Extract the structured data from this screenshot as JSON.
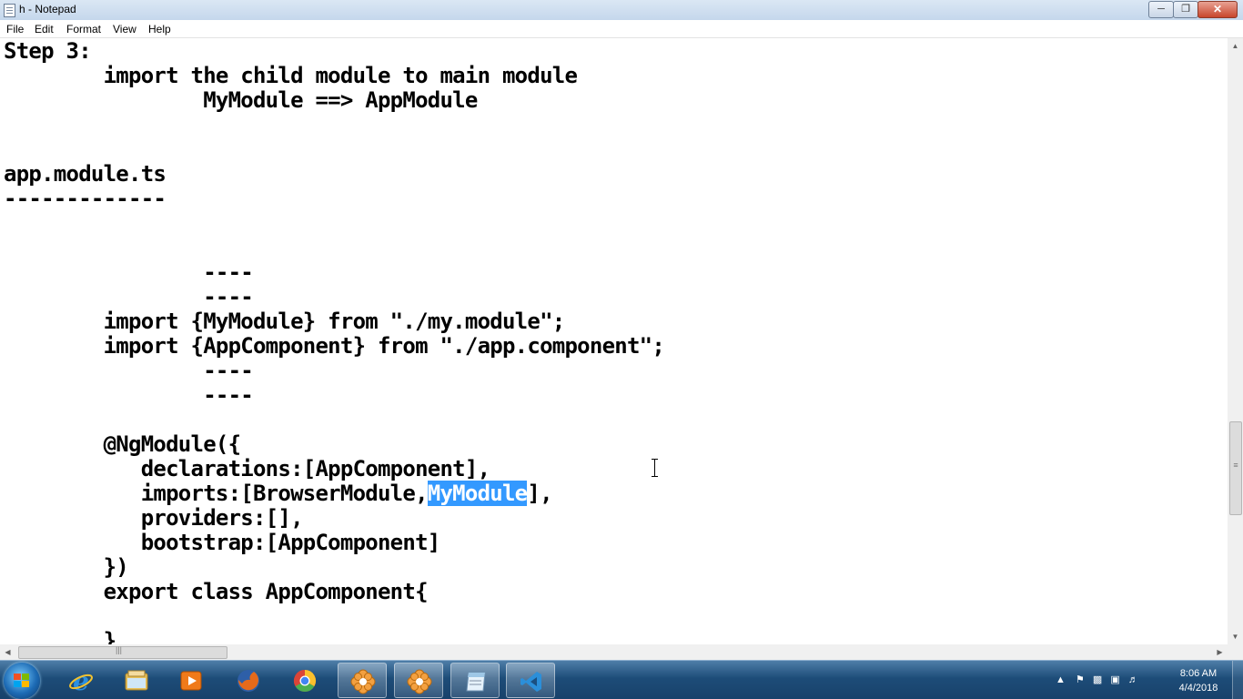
{
  "window": {
    "title": "h - Notepad",
    "controls": {
      "minimize": "minimize",
      "maximize": "restore",
      "close": "close"
    }
  },
  "menu": [
    "File",
    "Edit",
    "Format",
    "View",
    "Help"
  ],
  "editor": {
    "lines_before": "Step 3:\n\timport the child module to main module\n\t\tMyModule ==> AppModule\n\n\napp.module.ts\n-------------\n\n\n\t\t----\n\t\t----\n\timport {MyModule} from \"./my.module\";\n\timport {AppComponent} from \"./app.component\";\n\t\t----\n\t\t----\n\n\t@NgModule({\n\t   declarations:[AppComponent],\n\t   imports:[BrowserModule,",
    "selected_text": "MyModule",
    "lines_after": "],\n\t   providers:[],\n\t   bootstrap:[AppComponent]\n\t})\n\texport class AppComponent{\n\n\t}"
  },
  "taskbar": {
    "pinned": [
      {
        "name": "internet-explorer-icon",
        "color": "#2a8fe0"
      },
      {
        "name": "windows-explorer-icon",
        "color": "#e8c15a"
      },
      {
        "name": "media-player-icon",
        "color": "#f07a1a"
      },
      {
        "name": "firefox-icon",
        "color": "#e66a1a"
      },
      {
        "name": "chrome-icon",
        "color": "#4caf50"
      },
      {
        "name": "app-flower-icon-1",
        "color": "#f3a040"
      },
      {
        "name": "app-flower-icon-2",
        "color": "#f3a040"
      },
      {
        "name": "notepad-icon",
        "color": "#9ec7e6"
      },
      {
        "name": "vscode-icon",
        "color": "#2b8fd9"
      }
    ],
    "clock_time": "8:06 AM",
    "clock_date": "4/4/2018"
  },
  "colors": {
    "selection": "#3399ff",
    "taskbar": "#1d4c78"
  }
}
